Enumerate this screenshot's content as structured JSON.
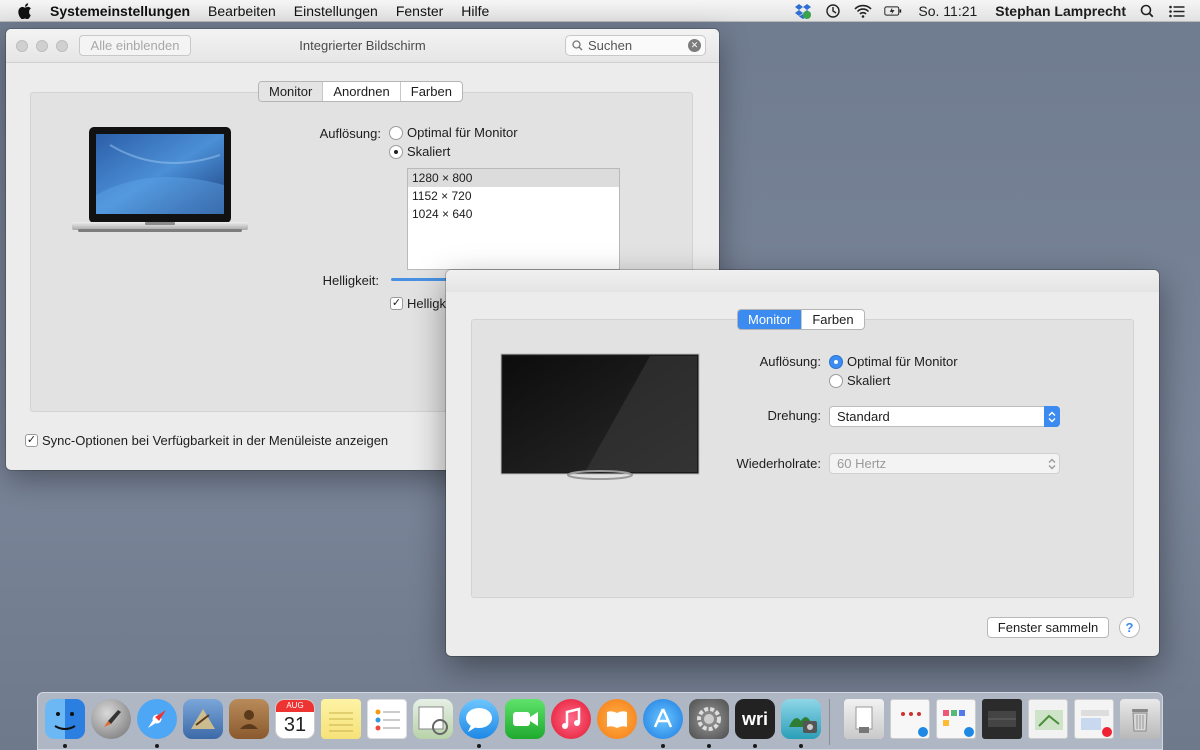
{
  "menubar": {
    "app_name": "Systemeinstellungen",
    "menus": [
      "Bearbeiten",
      "Einstellungen",
      "Fenster",
      "Hilfe"
    ],
    "clock": "So. 11:21",
    "user": "Stephan Lamprecht"
  },
  "window1": {
    "show_all_button": "Alle einblenden",
    "title": "Integrierter Bildschirm",
    "search_placeholder": "Suchen",
    "tabs": [
      "Monitor",
      "Anordnen",
      "Farben"
    ],
    "resolution_label": "Auflösung:",
    "resolution_options": [
      "Optimal für Monitor",
      "Skaliert"
    ],
    "resolution_list": [
      "1280 × 800",
      "1152 × 720",
      "1024 × 640"
    ],
    "brightness_label": "Helligkeit:",
    "auto_brightness_label": "Helligk",
    "sync_label": "Sync-Optionen bei Verfügbarkeit in der Menüleiste anzeigen"
  },
  "window2": {
    "tabs": [
      "Monitor",
      "Farben"
    ],
    "resolution_label": "Auflösung:",
    "resolution_options": [
      "Optimal für Monitor",
      "Skaliert"
    ],
    "rotation_label": "Drehung:",
    "rotation_value": "Standard",
    "refresh_label": "Wiederholrate:",
    "refresh_value": "60 Hertz",
    "gather_button": "Fenster sammeln",
    "help_button": "?"
  },
  "dock": {
    "calendar_month": "AUG",
    "calendar_day": "31",
    "wri_label": "wri"
  },
  "colors": {
    "accent_blue": "#3b8bf1",
    "desktop": "#7a8599"
  }
}
